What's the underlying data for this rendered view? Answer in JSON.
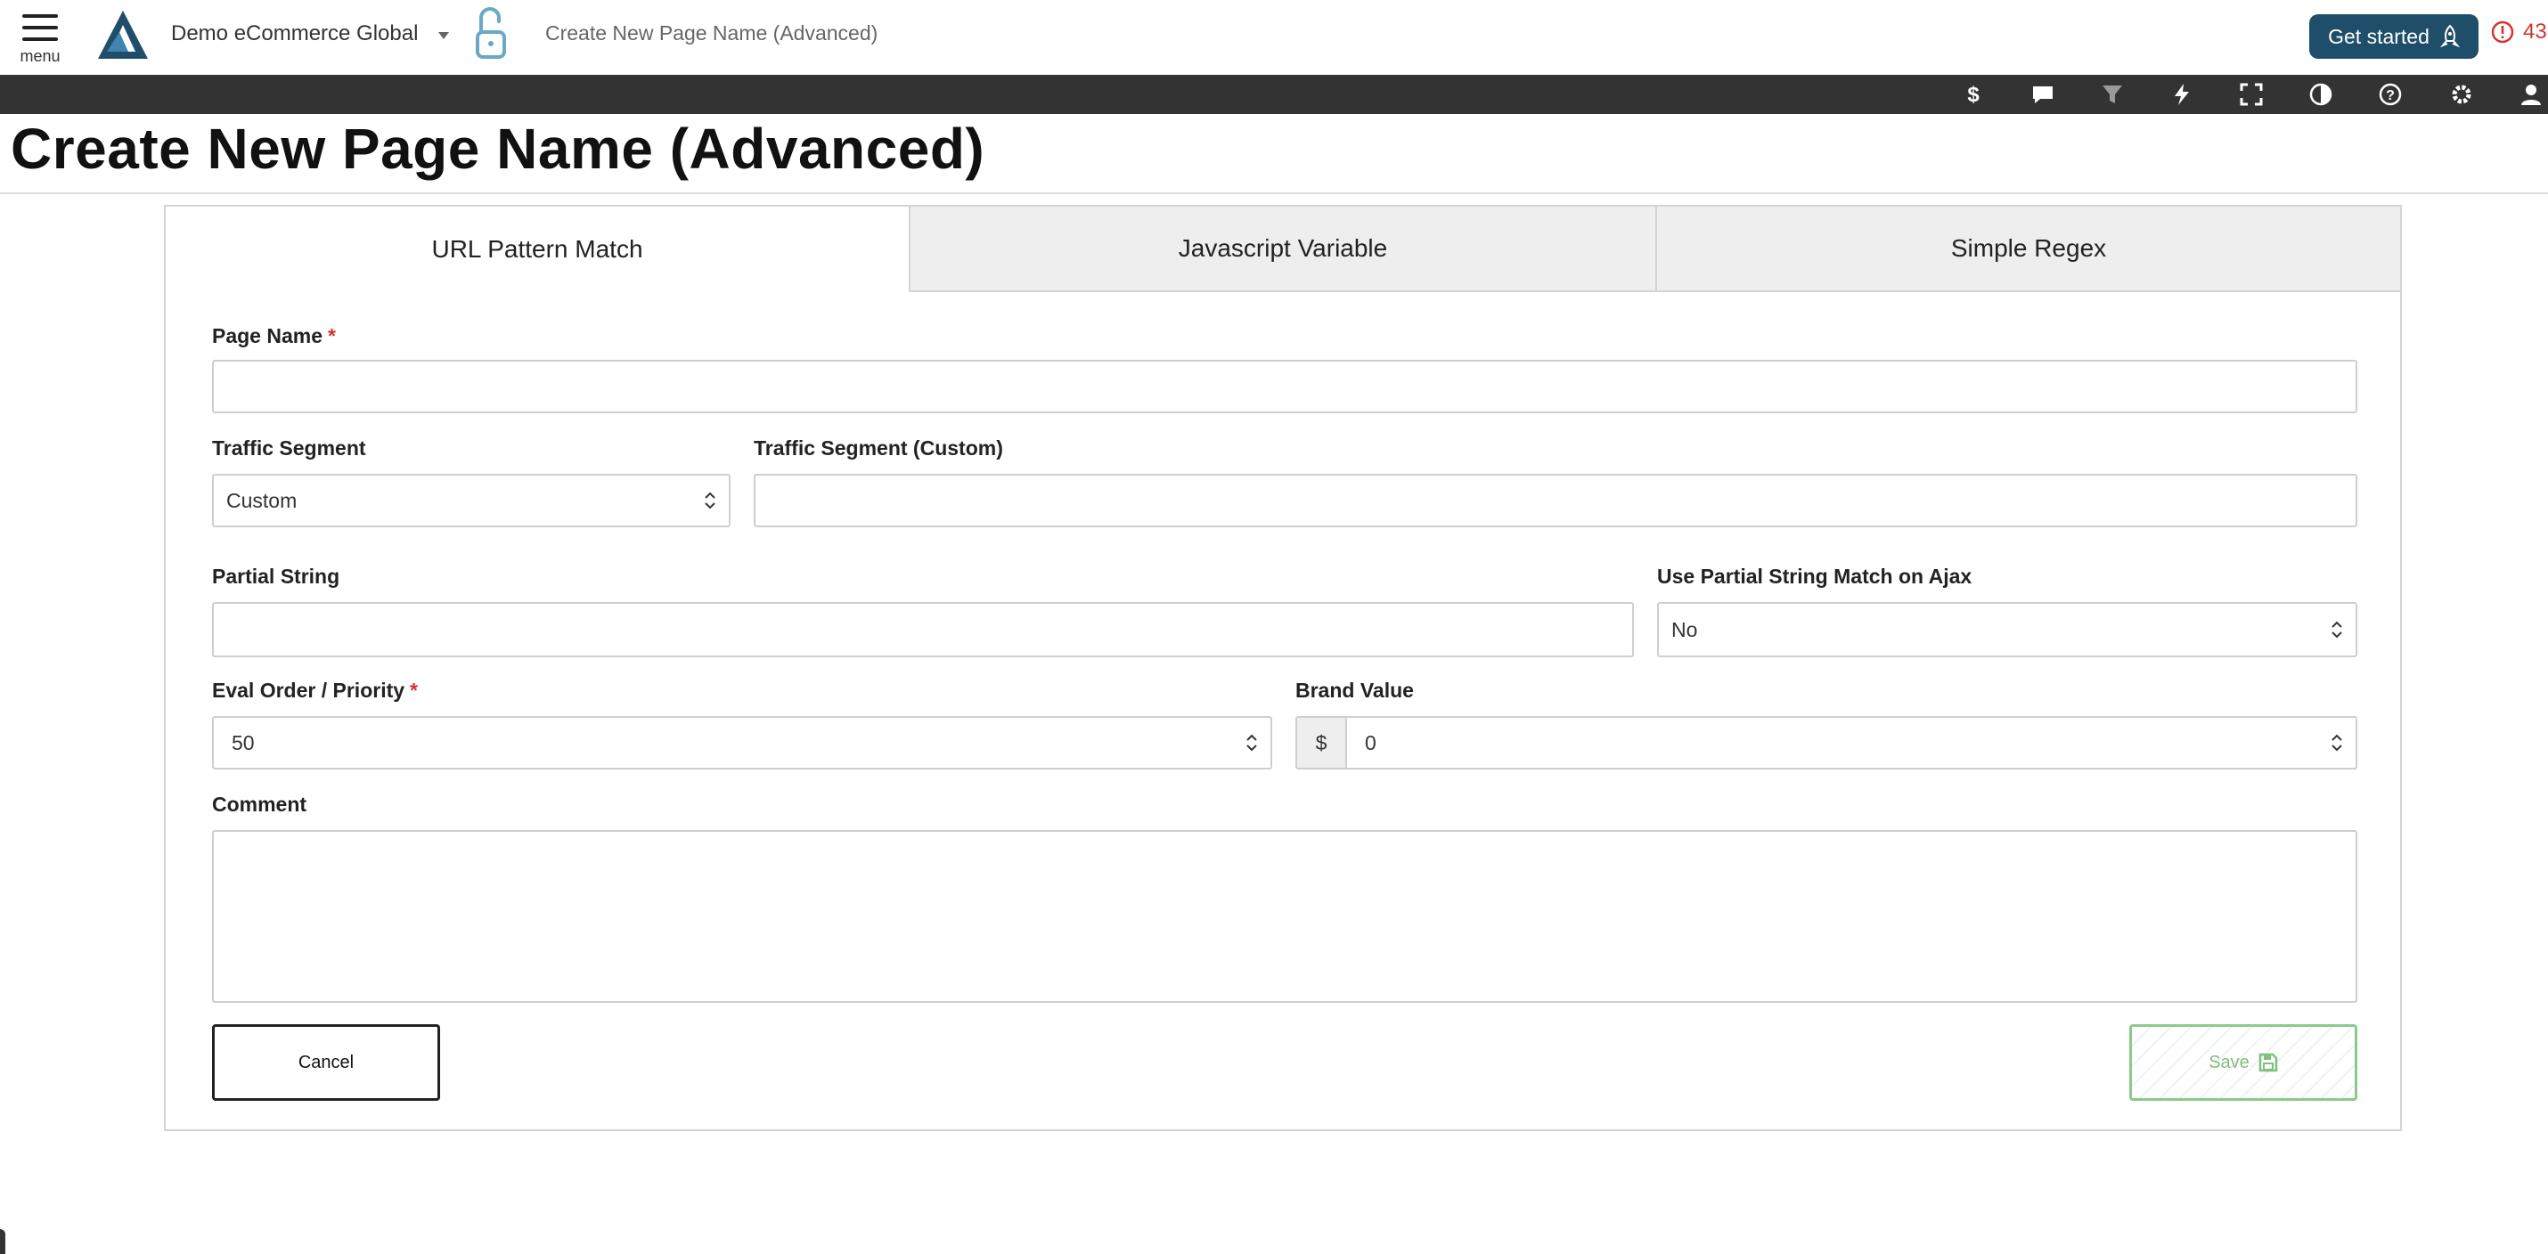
{
  "header": {
    "menu_label": "menu",
    "account_name": "Demo eCommerce Global",
    "page_crumb": "Create New Page Name (Advanced)",
    "get_started_label": "Get started",
    "alert_count": "43"
  },
  "toolbar": {
    "icons": [
      "dollar-icon",
      "comment-icon",
      "filter-icon",
      "bolt-icon",
      "fullscreen-icon",
      "contrast-icon",
      "help-icon",
      "gear-icon",
      "user-icon"
    ]
  },
  "page": {
    "title": "Create New Page Name (Advanced)"
  },
  "tabs": [
    {
      "label": "URL Pattern Match",
      "active": true
    },
    {
      "label": "Javascript Variable",
      "active": false
    },
    {
      "label": "Simple Regex",
      "active": false
    }
  ],
  "form": {
    "page_name": {
      "label": "Page Name",
      "required_mark": "*",
      "value": ""
    },
    "traffic_segment": {
      "label": "Traffic Segment",
      "value": "Custom"
    },
    "traffic_segment_custom": {
      "label": "Traffic Segment (Custom)",
      "value": ""
    },
    "partial_string": {
      "label": "Partial String",
      "value": ""
    },
    "use_partial_ajax": {
      "label": "Use Partial String Match on Ajax",
      "value": "No"
    },
    "eval_order": {
      "label": "Eval Order / Priority",
      "required_mark": "*",
      "value": "50"
    },
    "brand_value": {
      "label": "Brand Value",
      "prefix": "$",
      "value": "0"
    },
    "comment": {
      "label": "Comment",
      "value": ""
    }
  },
  "buttons": {
    "cancel": "Cancel",
    "save": "Save"
  },
  "colors": {
    "brand_dark": "#1f4e6b",
    "toolbar_bg": "#333333",
    "required": "#d0352f",
    "save_green": "#7fc07c"
  }
}
